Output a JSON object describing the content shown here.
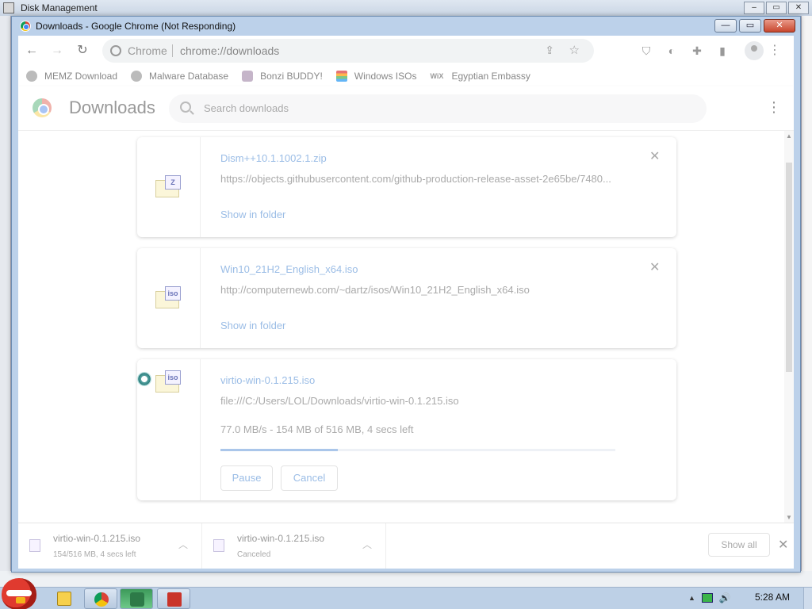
{
  "background_window": {
    "title": "Disk Management"
  },
  "window": {
    "title": "Downloads - Google Chrome (Not Responding)",
    "buttons": {
      "minimize": "—",
      "maximize": "▭",
      "close": "✕"
    }
  },
  "toolbar": {
    "back": "←",
    "forward": "→",
    "reload": "↻",
    "omnibox_host": "Chrome",
    "omnibox_url": "chrome://downloads"
  },
  "bookmarks": [
    {
      "label": "MEMZ Download",
      "icon": "globe-icon"
    },
    {
      "label": "Malware Database",
      "icon": "globe-icon"
    },
    {
      "label": "Bonzi BUDDY!",
      "icon": "bonzi-icon"
    },
    {
      "label": "Windows ISOs",
      "icon": "rainbow-stack-icon"
    },
    {
      "label": "Egyptian Embassy",
      "icon": "wix-icon",
      "icon_text": "WiX"
    }
  ],
  "downloads_page": {
    "title": "Downloads",
    "search_placeholder": "Search downloads"
  },
  "items": [
    {
      "filename": "Dism++10.1.1002.1.zip",
      "url": "https://objects.githubusercontent.com/github-production-release-asset-2e65be/7480...",
      "action": "Show in folder",
      "file_tag": "Z"
    },
    {
      "filename": "Win10_21H2_English_x64.iso",
      "url": "http://computernewb.com/~dartz/isos/Win10_21H2_English_x64.iso",
      "action": "Show in folder",
      "file_tag": "iso"
    },
    {
      "filename": "virtio-win-0.1.215.iso",
      "url": "file:///C:/Users/LOL/Downloads/virtio-win-0.1.215.iso",
      "status": "77.0 MB/s - 154 MB of 516 MB, 4 secs left",
      "progress": 0.298,
      "pause_label": "Pause",
      "cancel_label": "Cancel",
      "file_tag": "iso"
    }
  ],
  "shelf": {
    "items": [
      {
        "name": "virtio-win-0.1.215.iso",
        "status": "154/516 MB, 4 secs left"
      },
      {
        "name": "virtio-win-0.1.215.iso",
        "status": "Canceled"
      }
    ],
    "show_all": "Show all"
  },
  "taskbar": {
    "clock": "5:28 AM"
  },
  "colors": {
    "accent_link": "#9bbde6",
    "progress_fill": "#aac6ea",
    "taskbar": "#bdd0e6"
  }
}
